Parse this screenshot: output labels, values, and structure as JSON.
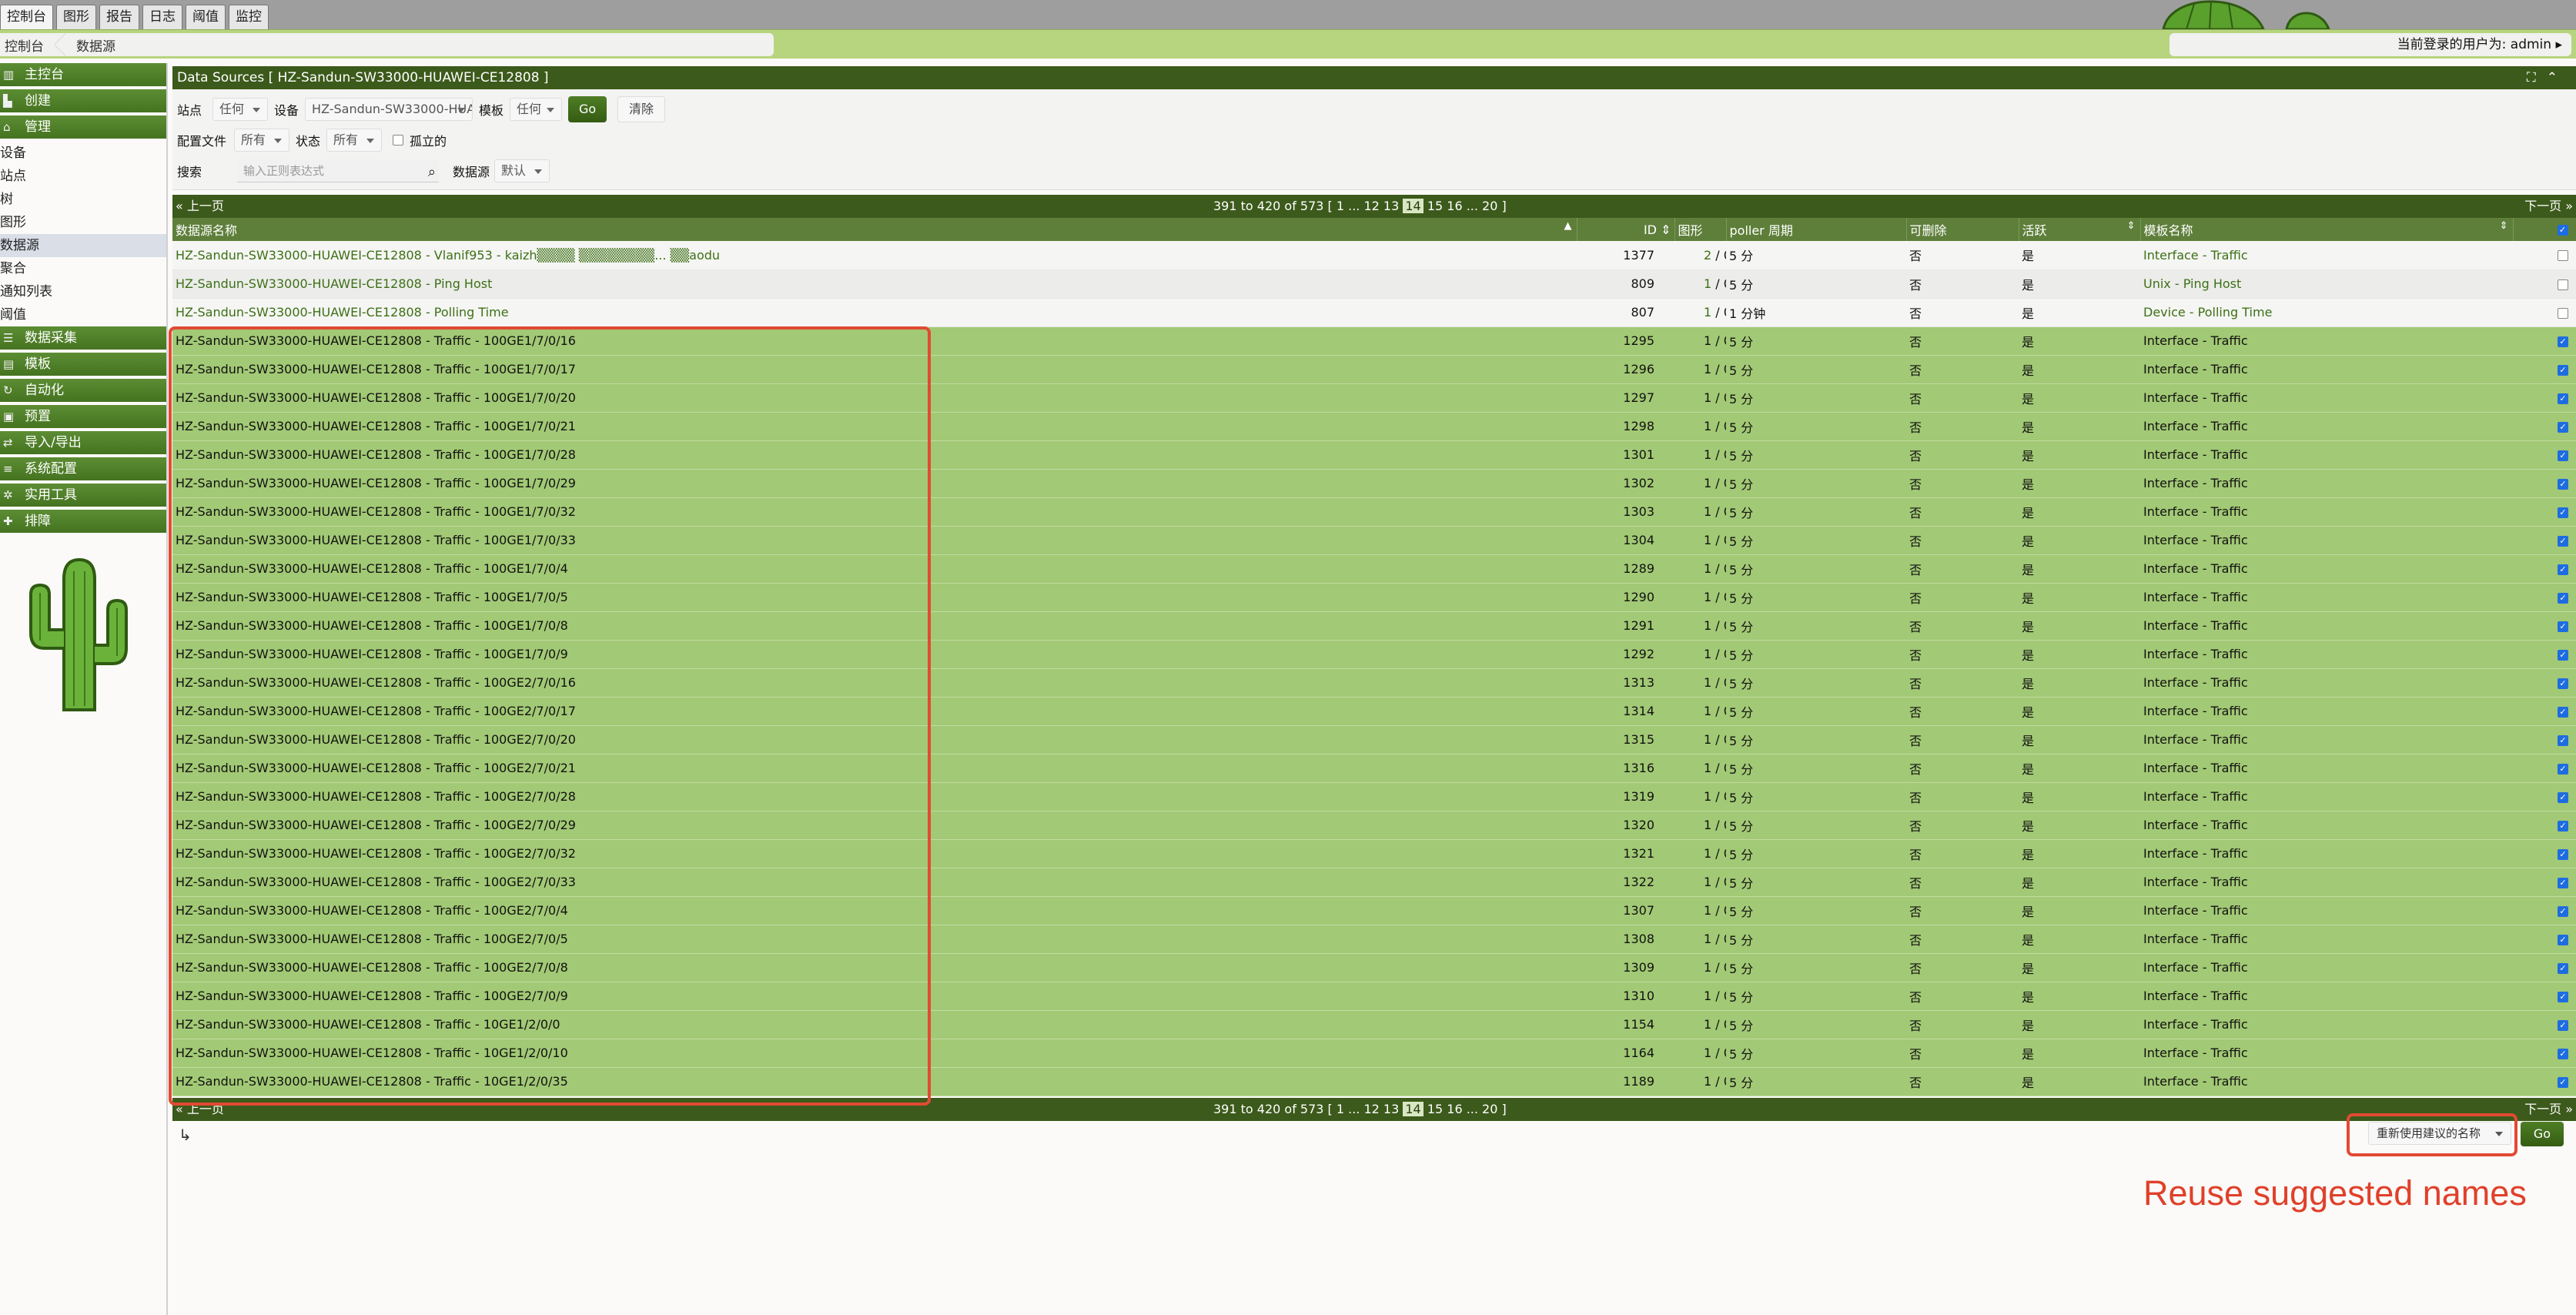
{
  "tabs": [
    "控制台",
    "图形",
    "报告",
    "日志",
    "阈值",
    "监控"
  ],
  "breadcrumb": [
    "控制台",
    "数据源"
  ],
  "user_text": "当前登录的用户为: admin ▸",
  "sidebar": {
    "headers_top": [
      {
        "icon": "map-icon",
        "label": "主控台"
      },
      {
        "icon": "bar-chart-icon",
        "label": "创建"
      },
      {
        "icon": "home-icon",
        "label": "管理"
      }
    ],
    "management_items": [
      "设备",
      "站点",
      "树",
      "图形",
      "数据源",
      "聚合",
      "通知列表",
      "阈值"
    ],
    "active_item": "数据源",
    "headers_bottom": [
      {
        "icon": "database-icon",
        "label": "数据采集"
      },
      {
        "icon": "template-icon",
        "label": "模板"
      },
      {
        "icon": "refresh-icon",
        "label": "自动化"
      },
      {
        "icon": "preset-icon",
        "label": "预置"
      },
      {
        "icon": "import-export-icon",
        "label": "导入/导出"
      },
      {
        "icon": "list-icon",
        "label": "系统配置"
      },
      {
        "icon": "tools-icon",
        "label": "实用工具"
      },
      {
        "icon": "troubleshoot-icon",
        "label": "排障"
      }
    ]
  },
  "panel": {
    "title": "Data Sources [ HZ-Sandun-SW33000-HUAWEI-CE12808 ]",
    "icons": [
      "expand-icon",
      "collapse-icon"
    ]
  },
  "filter": {
    "site_label": "站点",
    "site_value": "任何",
    "device_label": "设备",
    "device_value": "HZ-Sandun-SW33000-HUAWE",
    "template_label": "模板",
    "template_value": "任何",
    "go_label": "Go",
    "clear_label": "清除",
    "profile_label": "配置文件",
    "profile_value": "所有",
    "status_label": "状态",
    "status_value": "所有",
    "orphan_label": "孤立的",
    "search_label": "搜索",
    "search_placeholder": "输入正则表达式",
    "ds_label": "数据源",
    "ds_value": "默认"
  },
  "nav": {
    "prev": "« 上一页",
    "next": "下一页 »",
    "range": "391 to 420 of 573 [",
    "pages_before": " 1 ... 12 13 ",
    "current_page": "14",
    "pages_after": " 15 16 ... 20 ]"
  },
  "columns": {
    "name": "数据源名称",
    "id": "ID",
    "graphs": "图形",
    "poller": "poller 周期",
    "deletable": "可删除",
    "active": "活跃",
    "template": "模板名称"
  },
  "rows": [
    {
      "name": "HZ-Sandun-SW33000-HUAWEI-CE12808 - Vlanif953 - kaizh▒▒▒▒  ▒▒▒▒▒▒▒▒... ▒▒aodu",
      "id": "1377",
      "graph_a": "2",
      "graph_b": " / 0",
      "poller": "5 分",
      "deletable": "否",
      "active": "是",
      "template": "Interface - Traffic",
      "selected": false,
      "tpl_link": true
    },
    {
      "name": "HZ-Sandun-SW33000-HUAWEI-CE12808 - Ping Host",
      "id": "809",
      "graph_a": "1",
      "graph_b": " / 0",
      "poller": "5 分",
      "deletable": "否",
      "active": "是",
      "template": "Unix - Ping Host",
      "selected": false,
      "tpl_link": true
    },
    {
      "name": "HZ-Sandun-SW33000-HUAWEI-CE12808 - Polling Time",
      "id": "807",
      "graph_a": "1",
      "graph_b": " / 0",
      "poller": "1 分钟",
      "deletable": "否",
      "active": "是",
      "template": "Device - Polling Time",
      "selected": false,
      "tpl_link": true
    },
    {
      "name": "HZ-Sandun-SW33000-HUAWEI-CE12808 - Traffic - 100GE1/7/0/16",
      "id": "1295",
      "graph_a": "1",
      "graph_b": " / 0",
      "poller": "5 分",
      "deletable": "否",
      "active": "是",
      "template": "Interface - Traffic",
      "selected": true,
      "name_link": true
    },
    {
      "name": "HZ-Sandun-SW33000-HUAWEI-CE12808 - Traffic - 100GE1/7/0/17",
      "id": "1296",
      "graph_a": "1",
      "graph_b": " / 0",
      "poller": "5 分",
      "deletable": "否",
      "active": "是",
      "template": "Interface - Traffic",
      "selected": true
    },
    {
      "name": "HZ-Sandun-SW33000-HUAWEI-CE12808 - Traffic - 100GE1/7/0/20",
      "id": "1297",
      "graph_a": "1",
      "graph_b": " / 0",
      "poller": "5 分",
      "deletable": "否",
      "active": "是",
      "template": "Interface - Traffic",
      "selected": true
    },
    {
      "name": "HZ-Sandun-SW33000-HUAWEI-CE12808 - Traffic - 100GE1/7/0/21",
      "id": "1298",
      "graph_a": "1",
      "graph_b": " / 0",
      "poller": "5 分",
      "deletable": "否",
      "active": "是",
      "template": "Interface - Traffic",
      "selected": true
    },
    {
      "name": "HZ-Sandun-SW33000-HUAWEI-CE12808 - Traffic - 100GE1/7/0/28",
      "id": "1301",
      "graph_a": "1",
      "graph_b": " / 0",
      "poller": "5 分",
      "deletable": "否",
      "active": "是",
      "template": "Interface - Traffic",
      "selected": true
    },
    {
      "name": "HZ-Sandun-SW33000-HUAWEI-CE12808 - Traffic - 100GE1/7/0/29",
      "id": "1302",
      "graph_a": "1",
      "graph_b": " / 0",
      "poller": "5 分",
      "deletable": "否",
      "active": "是",
      "template": "Interface - Traffic",
      "selected": true
    },
    {
      "name": "HZ-Sandun-SW33000-HUAWEI-CE12808 - Traffic - 100GE1/7/0/32",
      "id": "1303",
      "graph_a": "1",
      "graph_b": " / 0",
      "poller": "5 分",
      "deletable": "否",
      "active": "是",
      "template": "Interface - Traffic",
      "selected": true
    },
    {
      "name": "HZ-Sandun-SW33000-HUAWEI-CE12808 - Traffic - 100GE1/7/0/33",
      "id": "1304",
      "graph_a": "1",
      "graph_b": " / 0",
      "poller": "5 分",
      "deletable": "否",
      "active": "是",
      "template": "Interface - Traffic",
      "selected": true
    },
    {
      "name": "HZ-Sandun-SW33000-HUAWEI-CE12808 - Traffic - 100GE1/7/0/4",
      "id": "1289",
      "graph_a": "1",
      "graph_b": " / 0",
      "poller": "5 分",
      "deletable": "否",
      "active": "是",
      "template": "Interface - Traffic",
      "selected": true
    },
    {
      "name": "HZ-Sandun-SW33000-HUAWEI-CE12808 - Traffic - 100GE1/7/0/5",
      "id": "1290",
      "graph_a": "1",
      "graph_b": " / 0",
      "poller": "5 分",
      "deletable": "否",
      "active": "是",
      "template": "Interface - Traffic",
      "selected": true
    },
    {
      "name": "HZ-Sandun-SW33000-HUAWEI-CE12808 - Traffic - 100GE1/7/0/8",
      "id": "1291",
      "graph_a": "1",
      "graph_b": " / 0",
      "poller": "5 分",
      "deletable": "否",
      "active": "是",
      "template": "Interface - Traffic",
      "selected": true
    },
    {
      "name": "HZ-Sandun-SW33000-HUAWEI-CE12808 - Traffic - 100GE1/7/0/9",
      "id": "1292",
      "graph_a": "1",
      "graph_b": " / 0",
      "poller": "5 分",
      "deletable": "否",
      "active": "是",
      "template": "Interface - Traffic",
      "selected": true
    },
    {
      "name": "HZ-Sandun-SW33000-HUAWEI-CE12808 - Traffic - 100GE2/7/0/16",
      "id": "1313",
      "graph_a": "1",
      "graph_b": " / 0",
      "poller": "5 分",
      "deletable": "否",
      "active": "是",
      "template": "Interface - Traffic",
      "selected": true
    },
    {
      "name": "HZ-Sandun-SW33000-HUAWEI-CE12808 - Traffic - 100GE2/7/0/17",
      "id": "1314",
      "graph_a": "1",
      "graph_b": " / 0",
      "poller": "5 分",
      "deletable": "否",
      "active": "是",
      "template": "Interface - Traffic",
      "selected": true
    },
    {
      "name": "HZ-Sandun-SW33000-HUAWEI-CE12808 - Traffic - 100GE2/7/0/20",
      "id": "1315",
      "graph_a": "1",
      "graph_b": " / 0",
      "poller": "5 分",
      "deletable": "否",
      "active": "是",
      "template": "Interface - Traffic",
      "selected": true
    },
    {
      "name": "HZ-Sandun-SW33000-HUAWEI-CE12808 - Traffic - 100GE2/7/0/21",
      "id": "1316",
      "graph_a": "1",
      "graph_b": " / 0",
      "poller": "5 分",
      "deletable": "否",
      "active": "是",
      "template": "Interface - Traffic",
      "selected": true
    },
    {
      "name": "HZ-Sandun-SW33000-HUAWEI-CE12808 - Traffic - 100GE2/7/0/28",
      "id": "1319",
      "graph_a": "1",
      "graph_b": " / 0",
      "poller": "5 分",
      "deletable": "否",
      "active": "是",
      "template": "Interface - Traffic",
      "selected": true
    },
    {
      "name": "HZ-Sandun-SW33000-HUAWEI-CE12808 - Traffic - 100GE2/7/0/29",
      "id": "1320",
      "graph_a": "1",
      "graph_b": " / 0",
      "poller": "5 分",
      "deletable": "否",
      "active": "是",
      "template": "Interface - Traffic",
      "selected": true
    },
    {
      "name": "HZ-Sandun-SW33000-HUAWEI-CE12808 - Traffic - 100GE2/7/0/32",
      "id": "1321",
      "graph_a": "1",
      "graph_b": " / 0",
      "poller": "5 分",
      "deletable": "否",
      "active": "是",
      "template": "Interface - Traffic",
      "selected": true
    },
    {
      "name": "HZ-Sandun-SW33000-HUAWEI-CE12808 - Traffic - 100GE2/7/0/33",
      "id": "1322",
      "graph_a": "1",
      "graph_b": " / 0",
      "poller": "5 分",
      "deletable": "否",
      "active": "是",
      "template": "Interface - Traffic",
      "selected": true
    },
    {
      "name": "HZ-Sandun-SW33000-HUAWEI-CE12808 - Traffic - 100GE2/7/0/4",
      "id": "1307",
      "graph_a": "1",
      "graph_b": " / 0",
      "poller": "5 分",
      "deletable": "否",
      "active": "是",
      "template": "Interface - Traffic",
      "selected": true
    },
    {
      "name": "HZ-Sandun-SW33000-HUAWEI-CE12808 - Traffic - 100GE2/7/0/5",
      "id": "1308",
      "graph_a": "1",
      "graph_b": " / 0",
      "poller": "5 分",
      "deletable": "否",
      "active": "是",
      "template": "Interface - Traffic",
      "selected": true
    },
    {
      "name": "HZ-Sandun-SW33000-HUAWEI-CE12808 - Traffic - 100GE2/7/0/8",
      "id": "1309",
      "graph_a": "1",
      "graph_b": " / 0",
      "poller": "5 分",
      "deletable": "否",
      "active": "是",
      "template": "Interface - Traffic",
      "selected": true
    },
    {
      "name": "HZ-Sandun-SW33000-HUAWEI-CE12808 - Traffic - 100GE2/7/0/9",
      "id": "1310",
      "graph_a": "1",
      "graph_b": " / 0",
      "poller": "5 分",
      "deletable": "否",
      "active": "是",
      "template": "Interface - Traffic",
      "selected": true
    },
    {
      "name": "HZ-Sandun-SW33000-HUAWEI-CE12808 - Traffic - 10GE1/2/0/0",
      "id": "1154",
      "graph_a": "1",
      "graph_b": " / 0",
      "poller": "5 分",
      "deletable": "否",
      "active": "是",
      "template": "Interface - Traffic",
      "selected": true
    },
    {
      "name": "HZ-Sandun-SW33000-HUAWEI-CE12808 - Traffic - 10GE1/2/0/10",
      "id": "1164",
      "graph_a": "1",
      "graph_b": " / 0",
      "poller": "5 分",
      "deletable": "否",
      "active": "是",
      "template": "Interface - Traffic",
      "selected": true
    },
    {
      "name": "HZ-Sandun-SW33000-HUAWEI-CE12808 - Traffic - 10GE1/2/0/35",
      "id": "1189",
      "graph_a": "1",
      "graph_b": " / 0",
      "poller": "5 分",
      "deletable": "否",
      "active": "是",
      "template": "Interface - Traffic",
      "selected": true
    }
  ],
  "actions": {
    "corner_glyph": "↳",
    "select_value": "重新使用建议的名称",
    "go_label": "Go"
  },
  "annotation_text": "Reuse suggested names",
  "colors": {
    "header_green": "#3c5a1b",
    "selected_row": "#a2c975",
    "annotation_red": "#e24a33"
  }
}
